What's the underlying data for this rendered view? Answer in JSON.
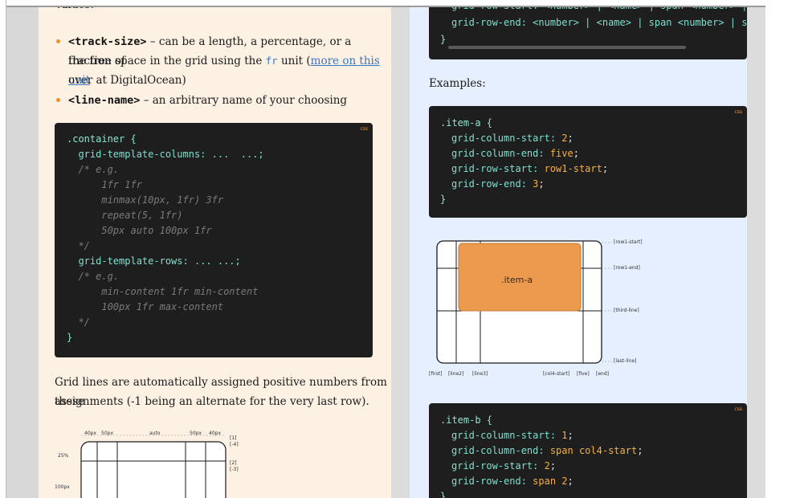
{
  "left": {
    "values_heading": "Values:",
    "bullets": [
      {
        "term": "<track-size>",
        "line1": " – can be a length, a percentage, or a fraction of",
        "line2_pre": "the free space in the grid using the ",
        "inline_code": "fr",
        "line2_mid": " unit (",
        "link_text": "more on this unit",
        "line3": "over at DigitalOcean)"
      },
      {
        "term": "<line-name>",
        "line1": " – an arbitrary name of your choosing"
      }
    ],
    "code": {
      "tag": "css",
      "lines": [
        ".container {",
        "  grid-template-columns: ...  ...;",
        "  /* e.g.",
        "      1fr 1fr",
        "      minmax(10px, 1fr) 3fr",
        "      repeat(5, 1fr)",
        "      50px auto 100px 1fr",
        "  */",
        "  grid-template-rows: ... ...;",
        "  /* e.g.",
        "      min-content 1fr min-content",
        "      100px 1fr max-content",
        "  */",
        "}"
      ]
    },
    "para_line1": "Grid lines are automatically assigned positive numbers from these",
    "para_line2": "assignments (-1 being an alternate for the very last row).",
    "diagram_labels": {
      "col_40a": "40px",
      "col_50a": "50px",
      "col_auto": "auto",
      "col_50b": "50px",
      "col_40b": "40px",
      "row_25": "25%",
      "row_100": "100px",
      "r1": "[1]",
      "r1n": "[-4]",
      "r2": "[2]",
      "r2n": "[-3]"
    }
  },
  "right": {
    "top_code": {
      "line1": "grid-row-start: <number> | <name> | span <number> | span",
      "line2": "grid-row-end: <number> | <name> | span <number> | span <",
      "line3": "}"
    },
    "examples_label": "Examples:",
    "code_a": {
      "tag": "css",
      "sel": ".item-a {",
      "p1": "grid-column-start:",
      "v1": "2",
      "p2": "grid-column-end:",
      "v2": "five",
      "p3": "grid-row-start:",
      "v3": "row1-start",
      "p4": "grid-row-end:",
      "v4": "3",
      "close": "}"
    },
    "diagram": {
      "item_label": ".item-a",
      "row_labels": [
        "[row1-start]",
        "[row1-end]",
        "[third-line]",
        "[last-line]"
      ],
      "col_labels": [
        "[first]",
        "[line2]",
        "[line3]",
        "[col4-start]",
        "[five]",
        "[end]"
      ],
      "item_color": "#ec9a4e"
    },
    "code_b": {
      "tag": "css",
      "sel": ".item-b {",
      "p1": "grid-column-start:",
      "v1": "1",
      "p2": "grid-column-end:",
      "v2": "span col4-start",
      "p3": "grid-row-start:",
      "v3": "2",
      "p4": "grid-row-end:",
      "v4": "span 2",
      "close": "}"
    }
  },
  "colors": {
    "left_bg": "#fdf1e4",
    "right_bg": "#e6efff",
    "code_bg": "#1e1e1e",
    "accent_orange": "#f0922a",
    "link_blue": "#3a78c2"
  }
}
